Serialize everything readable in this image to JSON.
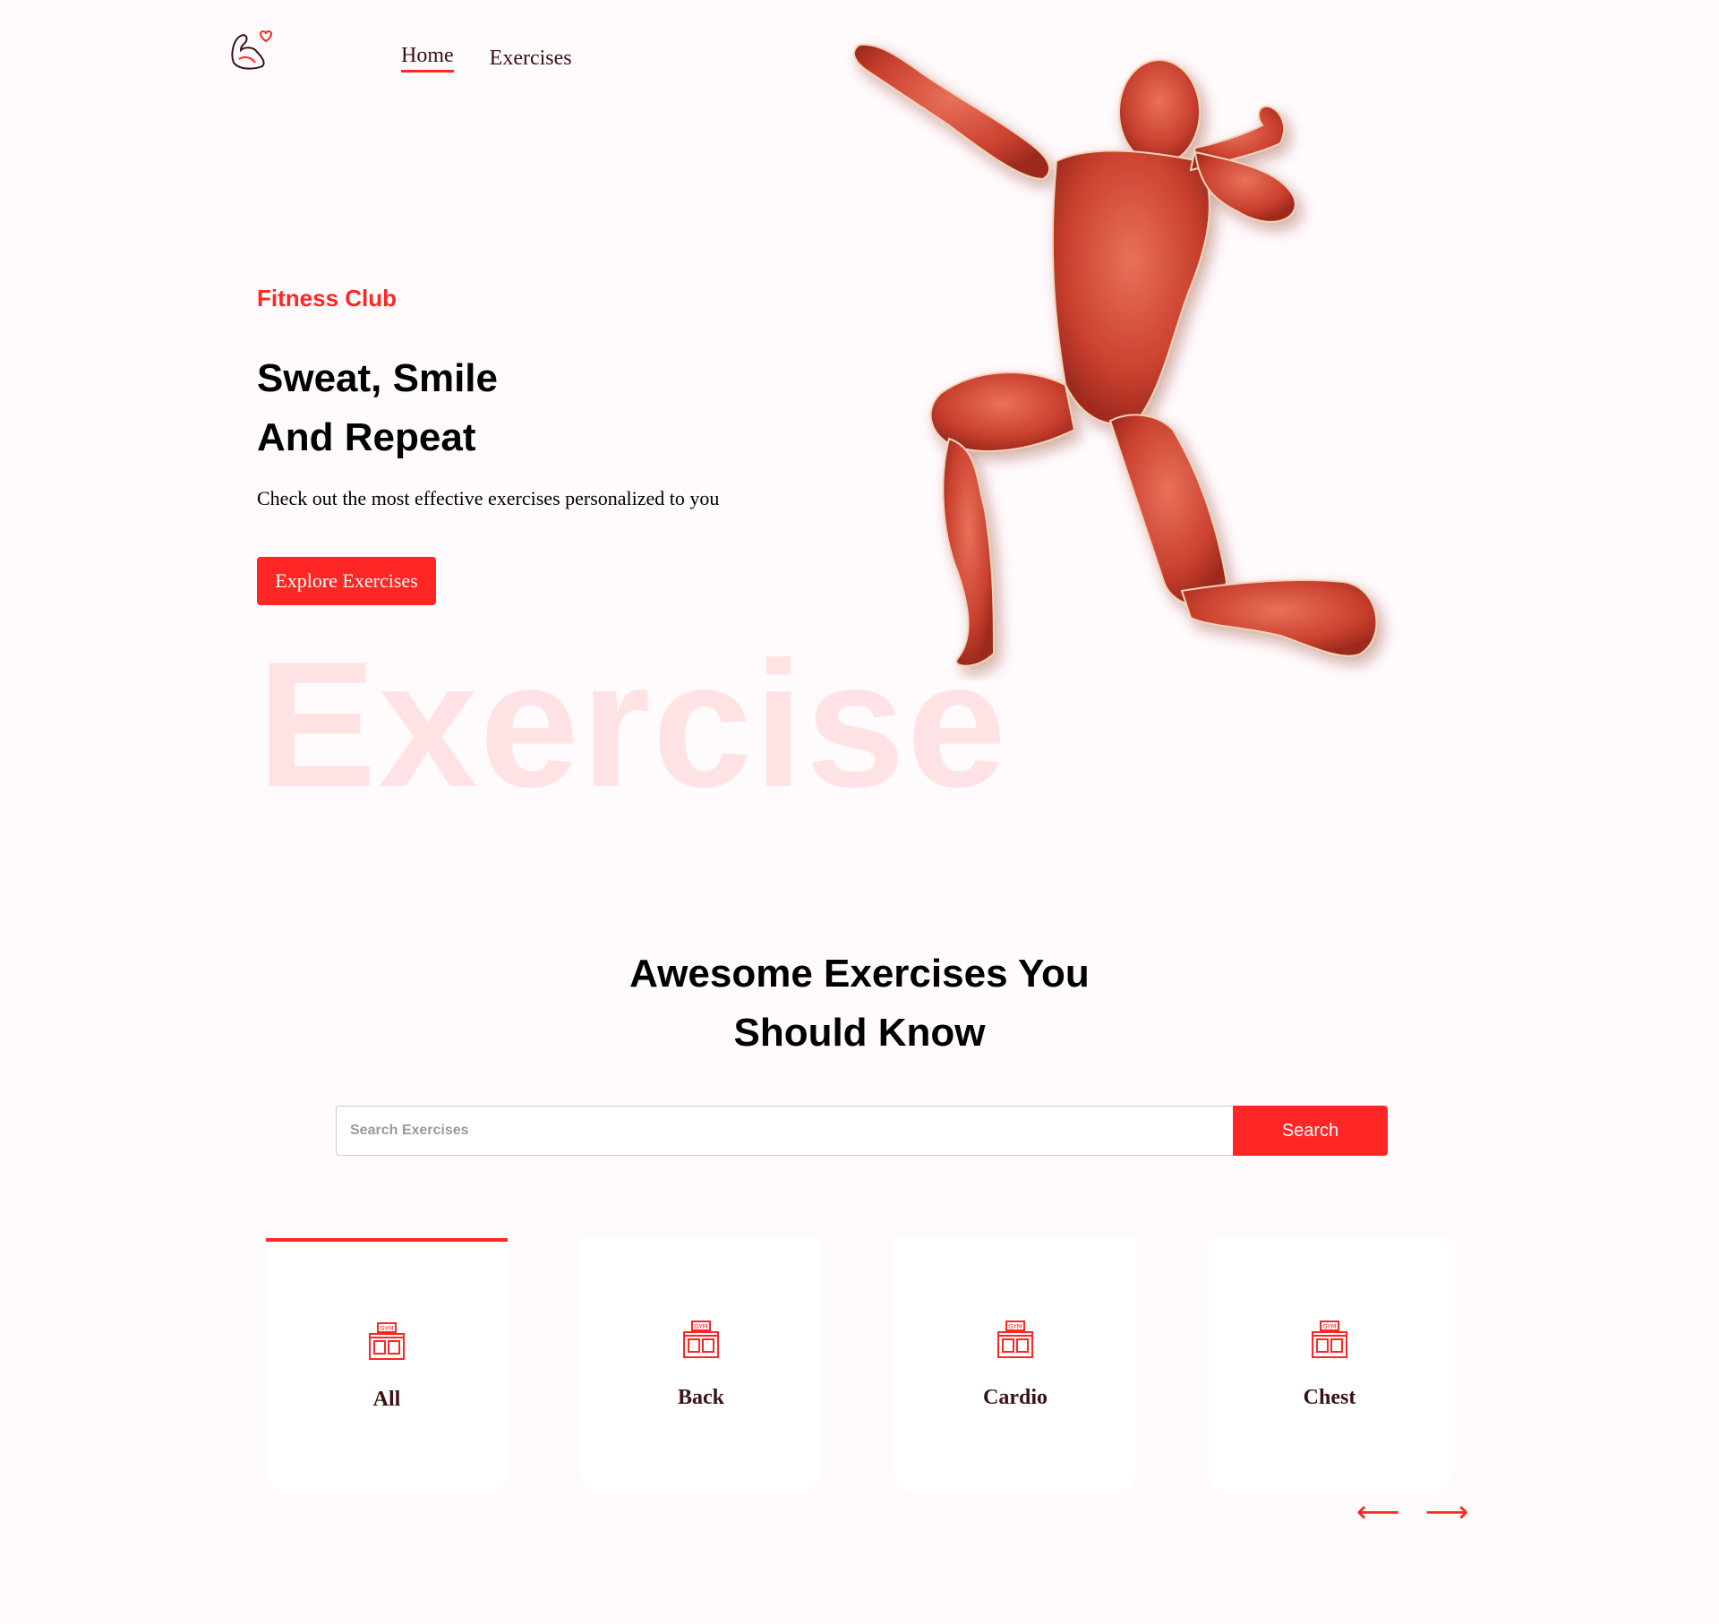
{
  "nav": {
    "logo_icon": "flexed-arm-heart-icon",
    "links": [
      {
        "label": "Home",
        "active": true
      },
      {
        "label": "Exercises",
        "active": false
      }
    ]
  },
  "hero": {
    "subtitle": "Fitness Club",
    "title_line1": "Sweat, Smile",
    "title_line2": "And Repeat",
    "description": "Check out the most effective exercises personalized to you",
    "button_label": "Explore Exercises",
    "watermark": "Exercise",
    "image": "muscular-anatomy-figure"
  },
  "section": {
    "title_line1": "Awesome Exercises You",
    "title_line2": "Should Know"
  },
  "search": {
    "placeholder": "Search Exercises",
    "value": "",
    "button_label": "Search"
  },
  "categories": [
    {
      "label": "All",
      "icon": "gym-icon",
      "active": true
    },
    {
      "label": "Back",
      "icon": "gym-icon",
      "active": false
    },
    {
      "label": "Cardio",
      "icon": "gym-icon",
      "active": false
    },
    {
      "label": "Chest",
      "icon": "gym-icon",
      "active": false
    }
  ],
  "pager": {
    "prev_icon": "arrow-left-icon",
    "next_icon": "arrow-right-icon",
    "prev_glyph": "⟵",
    "next_glyph": "⟶"
  },
  "colors": {
    "accent": "#ff2625",
    "background": "#fffafb",
    "text_dark": "#3a1212"
  }
}
